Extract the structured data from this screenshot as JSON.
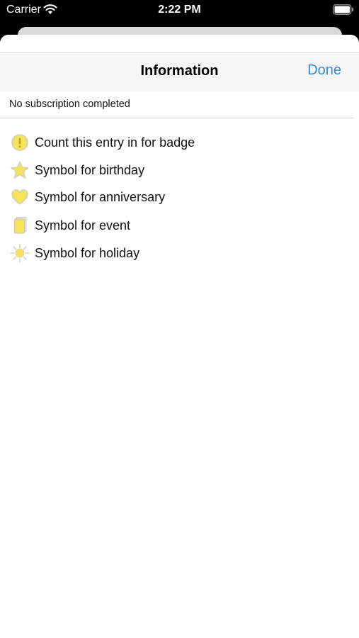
{
  "status_bar": {
    "carrier": "Carrier",
    "time": "2:22 PM"
  },
  "nav": {
    "title": "Information",
    "done_label": "Done"
  },
  "subscription_status": "No subscription completed",
  "legend": [
    {
      "icon": "badge-count-icon",
      "label": "Count this entry in for badge"
    },
    {
      "icon": "star-icon",
      "label": "Symbol for birthday"
    },
    {
      "icon": "heart-icon",
      "label": "Symbol for anniversary"
    },
    {
      "icon": "event-document-icon",
      "label": "Symbol for event"
    },
    {
      "icon": "sun-icon",
      "label": "Symbol for holiday"
    }
  ],
  "colors": {
    "accent": "#2f8ae0",
    "symbol_yellow": "#f7e35a"
  }
}
